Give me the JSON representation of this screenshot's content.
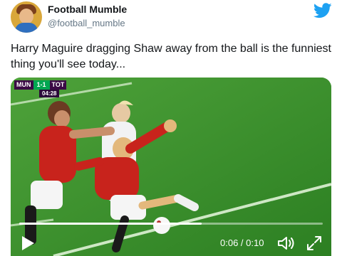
{
  "author": {
    "name": "Football Mumble",
    "handle": "@football_mumble",
    "avatar_icon": "avatar-icon"
  },
  "brand": {
    "icon": "twitter-bird-icon",
    "color": "#1da1f2"
  },
  "tweet": {
    "text": "Harry Maguire dragging Shaw away from the ball is the funniest thing you'll see today..."
  },
  "video": {
    "scorebug": {
      "home": "MUN",
      "score": "1-1",
      "away": "TOT",
      "clock": "04:28"
    },
    "timecode": "0:06 / 0:10",
    "progress": 0.6,
    "icons": {
      "play": "play-icon",
      "volume": "volume-icon",
      "fullscreen": "fullscreen-icon"
    }
  }
}
